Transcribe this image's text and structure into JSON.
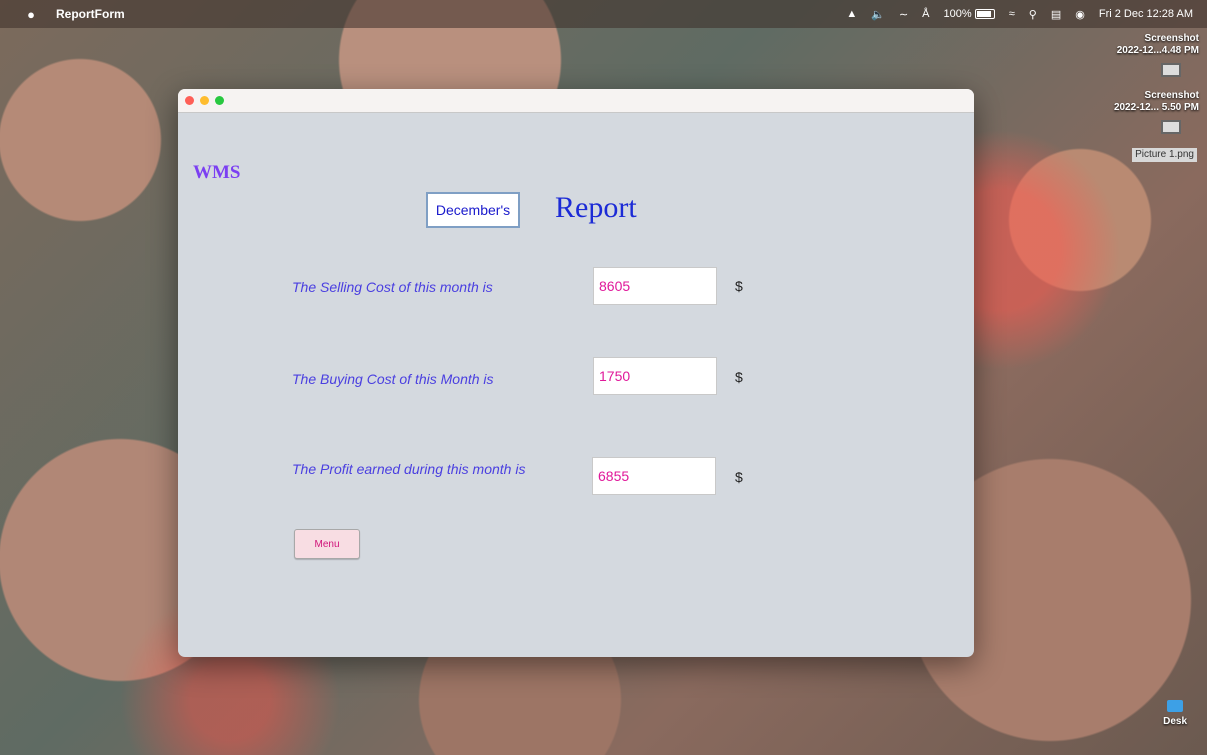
{
  "menubar": {
    "app_name": "ReportForm",
    "battery": "100%",
    "datetime": "Fri 2 Dec  12:28 AM"
  },
  "desktop": {
    "items": [
      {
        "line1": "Screenshot",
        "line2": "2022-12...4.48 PM"
      },
      {
        "line1": "Screenshot",
        "line2": "2022-12... 5.50 PM"
      },
      {
        "line1": "Picture 1.png",
        "line2": ""
      }
    ],
    "folder": "Desk"
  },
  "window": {
    "brand": "WMS",
    "month_value": "December's",
    "title": "Report",
    "rows": [
      {
        "label": "The Selling Cost of this month is",
        "value": "8605",
        "unit": "$"
      },
      {
        "label": "The Buying Cost of this Month is",
        "value": "1750",
        "unit": "$"
      },
      {
        "label": "The Profit earned during this month is",
        "value": "6855",
        "unit": "$"
      }
    ],
    "menu_button": "Menu"
  }
}
